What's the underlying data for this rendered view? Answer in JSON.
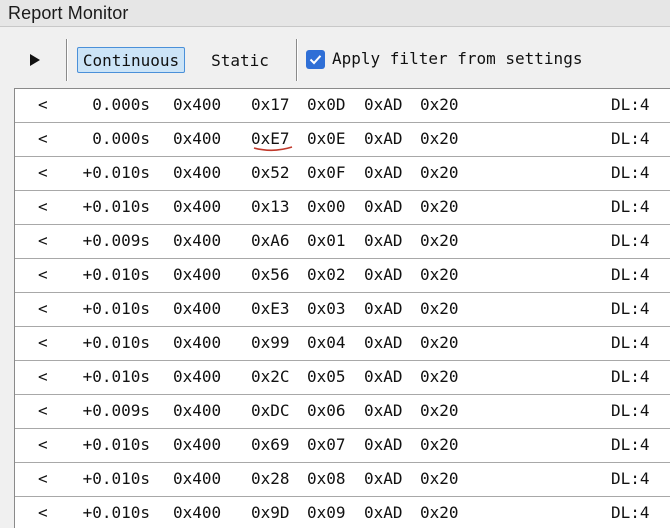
{
  "window": {
    "title": "Report Monitor"
  },
  "toolbar": {
    "play_icon": "play-icon",
    "continuous_label": "Continuous",
    "continuous_active": true,
    "static_label": "Static",
    "filter_checked": true,
    "filter_label": "Apply filter from settings"
  },
  "colors": {
    "accent": "#2f6fd6",
    "active_button_bg": "#cce4f7",
    "annotation": "#c0392b"
  },
  "rows": [
    {
      "dir": "<",
      "time": "0.000s",
      "id": "0x400",
      "b0": "0x17",
      "b1": "0x0D",
      "b2": "0xAD",
      "b3": "0x20",
      "dl": "DL:4"
    },
    {
      "dir": "<",
      "time": "0.000s",
      "id": "0x400",
      "b0": "0xE7",
      "b1": "0x0E",
      "b2": "0xAD",
      "b3": "0x20",
      "dl": "DL:4",
      "annotated": true
    },
    {
      "dir": "<",
      "time": "+0.010s",
      "id": "0x400",
      "b0": "0x52",
      "b1": "0x0F",
      "b2": "0xAD",
      "b3": "0x20",
      "dl": "DL:4"
    },
    {
      "dir": "<",
      "time": "+0.010s",
      "id": "0x400",
      "b0": "0x13",
      "b1": "0x00",
      "b2": "0xAD",
      "b3": "0x20",
      "dl": "DL:4"
    },
    {
      "dir": "<",
      "time": "+0.009s",
      "id": "0x400",
      "b0": "0xA6",
      "b1": "0x01",
      "b2": "0xAD",
      "b3": "0x20",
      "dl": "DL:4"
    },
    {
      "dir": "<",
      "time": "+0.010s",
      "id": "0x400",
      "b0": "0x56",
      "b1": "0x02",
      "b2": "0xAD",
      "b3": "0x20",
      "dl": "DL:4"
    },
    {
      "dir": "<",
      "time": "+0.010s",
      "id": "0x400",
      "b0": "0xE3",
      "b1": "0x03",
      "b2": "0xAD",
      "b3": "0x20",
      "dl": "DL:4"
    },
    {
      "dir": "<",
      "time": "+0.010s",
      "id": "0x400",
      "b0": "0x99",
      "b1": "0x04",
      "b2": "0xAD",
      "b3": "0x20",
      "dl": "DL:4"
    },
    {
      "dir": "<",
      "time": "+0.010s",
      "id": "0x400",
      "b0": "0x2C",
      "b1": "0x05",
      "b2": "0xAD",
      "b3": "0x20",
      "dl": "DL:4"
    },
    {
      "dir": "<",
      "time": "+0.009s",
      "id": "0x400",
      "b0": "0xDC",
      "b1": "0x06",
      "b2": "0xAD",
      "b3": "0x20",
      "dl": "DL:4"
    },
    {
      "dir": "<",
      "time": "+0.010s",
      "id": "0x400",
      "b0": "0x69",
      "b1": "0x07",
      "b2": "0xAD",
      "b3": "0x20",
      "dl": "DL:4"
    },
    {
      "dir": "<",
      "time": "+0.010s",
      "id": "0x400",
      "b0": "0x28",
      "b1": "0x08",
      "b2": "0xAD",
      "b3": "0x20",
      "dl": "DL:4"
    },
    {
      "dir": "<",
      "time": "+0.010s",
      "id": "0x400",
      "b0": "0x9D",
      "b1": "0x09",
      "b2": "0xAD",
      "b3": "0x20",
      "dl": "DL:4"
    }
  ]
}
